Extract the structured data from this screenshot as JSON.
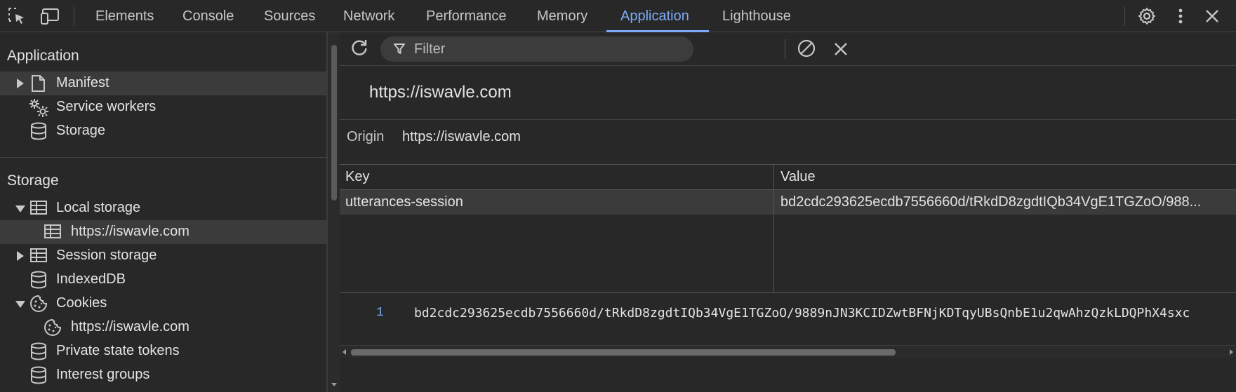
{
  "toolbar": {
    "tabs": [
      {
        "label": "Elements"
      },
      {
        "label": "Console"
      },
      {
        "label": "Sources"
      },
      {
        "label": "Network"
      },
      {
        "label": "Performance"
      },
      {
        "label": "Memory"
      },
      {
        "label": "Application",
        "active": true
      },
      {
        "label": "Lighthouse"
      }
    ],
    "icons": [
      "inspect-element-icon",
      "device-toggle-icon",
      "settings-gear-icon",
      "more-vertical-icon",
      "close-icon"
    ]
  },
  "sidebar": {
    "application_heading": "Application",
    "application_items": [
      {
        "label": "Manifest",
        "icon": "document-icon",
        "expandable": true,
        "selected": true
      },
      {
        "label": "Service workers",
        "icon": "gears-icon"
      },
      {
        "label": "Storage",
        "icon": "database-icon"
      }
    ],
    "storage_heading": "Storage",
    "storage_items": [
      {
        "label": "Local storage",
        "icon": "table-icon",
        "expanded": true
      },
      {
        "label": "https://iswavle.com",
        "icon": "table-icon",
        "child": true,
        "selected": true
      },
      {
        "label": "Session storage",
        "icon": "table-icon",
        "expandable": true
      },
      {
        "label": "IndexedDB",
        "icon": "database-icon"
      },
      {
        "label": "Cookies",
        "icon": "cookie-icon",
        "expanded": true
      },
      {
        "label": "https://iswavle.com",
        "icon": "cookie-icon",
        "child": true
      },
      {
        "label": "Private state tokens",
        "icon": "database-icon"
      },
      {
        "label": "Interest groups",
        "icon": "database-icon"
      }
    ]
  },
  "main": {
    "filter_placeholder": "Filter",
    "origin_title": "https://iswavle.com",
    "origin_label": "Origin",
    "origin_value": "https://iswavle.com",
    "table": {
      "columns": [
        "Key",
        "Value"
      ],
      "rows": [
        {
          "key": "utterances-session",
          "value": "bd2cdc293625ecdb7556660d/tRkdD8zgdtIQb34VgE1TGZoO/988..."
        }
      ]
    },
    "preview": {
      "line_number": "1",
      "text": "bd2cdc293625ecdb7556660d/tRkdD8zgdtIQb34VgE1TGZoO/9889nJN3KCIDZwtBFNjKDTqyUBsQnbE1u2qwAhzQzkLDQPhX4sxc"
    }
  },
  "colors": {
    "accent": "#7cacf8",
    "background": "#282828",
    "selected_row": "#3b3b3b"
  }
}
